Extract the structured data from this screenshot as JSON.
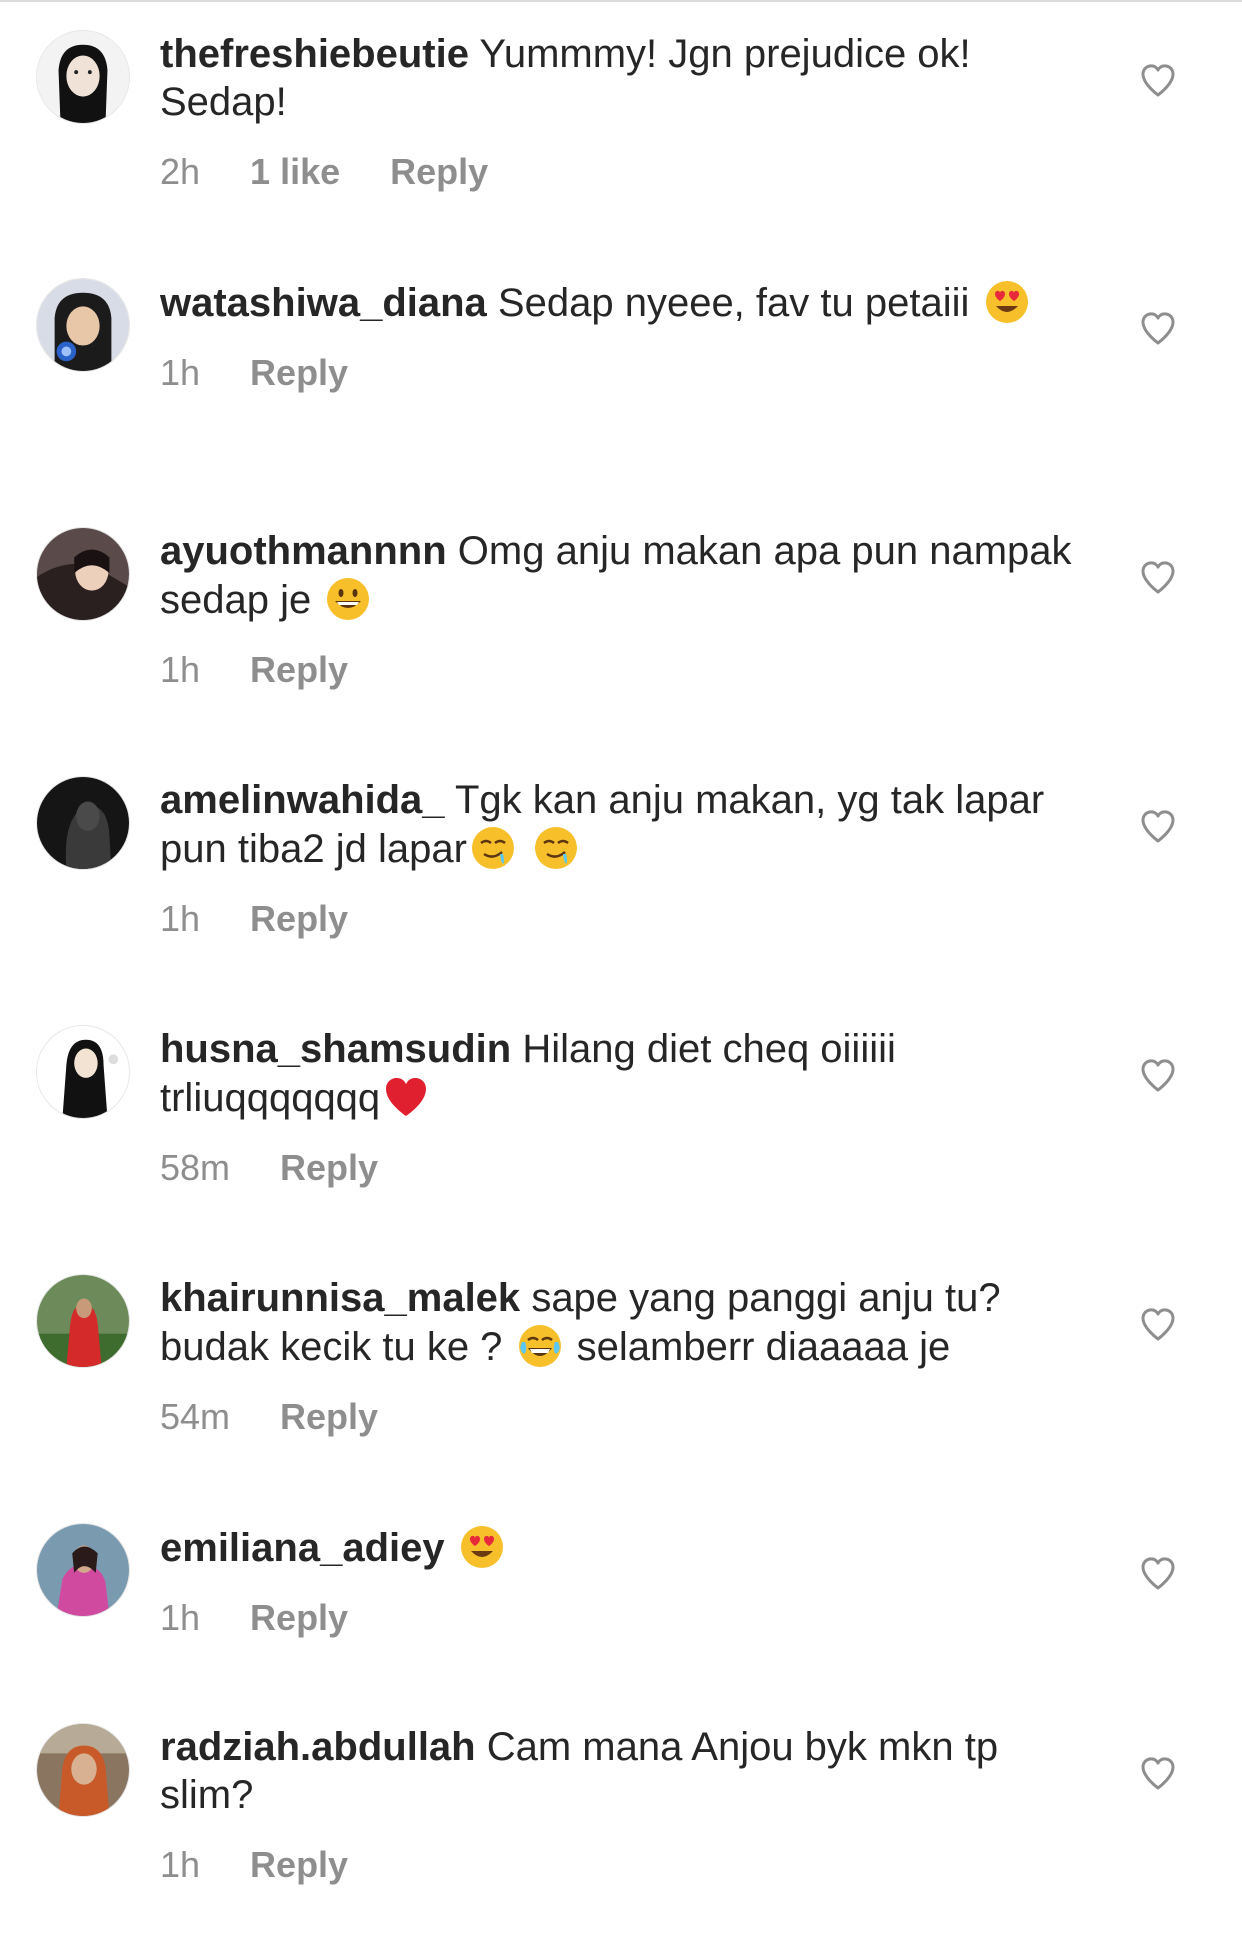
{
  "comments": [
    {
      "username": "thefreshiebeutie",
      "text": "Yummmy! Jgn prejudice ok! Sedap!",
      "time": "2h",
      "likes": "1 like",
      "reply": "Reply",
      "emojis": []
    },
    {
      "username": "watashiwa_diana",
      "text": "Sedap nyeee, fav tu petaiii",
      "time": "1h",
      "likes": "",
      "reply": "Reply",
      "emojis": [
        "heart-eyes-emoji"
      ]
    },
    {
      "username": "ayuothmannnn",
      "text": "Omg anju makan apa pun nampak sedap je",
      "time": "1h",
      "likes": "",
      "reply": "Reply",
      "emojis": [
        "grinning-emoji"
      ]
    },
    {
      "username": "amelinwahida_",
      "text": "Tgk kan anju makan, yg tak lapar pun tiba2 jd lapar",
      "time": "1h",
      "likes": "",
      "reply": "Reply",
      "emojis": [
        "drooling-emoji",
        "drooling-emoji"
      ]
    },
    {
      "username": "husna_shamsudin",
      "text": "Hilang diet cheq oiiiiii trliuqqqqqqq",
      "time": "58m",
      "likes": "",
      "reply": "Reply",
      "emojis": [
        "red-heart-emoji"
      ]
    },
    {
      "username": "khairunnisa_malek",
      "text": "sape yang panggi anju tu? budak kecik tu ke ?",
      "text_after": "selamberr diaaaaa je",
      "time": "54m",
      "likes": "",
      "reply": "Reply",
      "emojis": [
        "tears-of-joy-emoji"
      ]
    },
    {
      "username": "emiliana_adiey",
      "text": "",
      "time": "1h",
      "likes": "",
      "reply": "Reply",
      "emojis": [
        "heart-eyes-emoji"
      ]
    },
    {
      "username": "radziah.abdullah",
      "text": "Cam mana Anjou byk mkn tp slim?",
      "time": "1h",
      "likes": "",
      "reply": "Reply",
      "emojis": []
    }
  ],
  "colors": {
    "text": "#262626",
    "meta": "#8e8e8e",
    "divider": "#dbdbdb",
    "heart_icon": "#8e8e8e"
  }
}
